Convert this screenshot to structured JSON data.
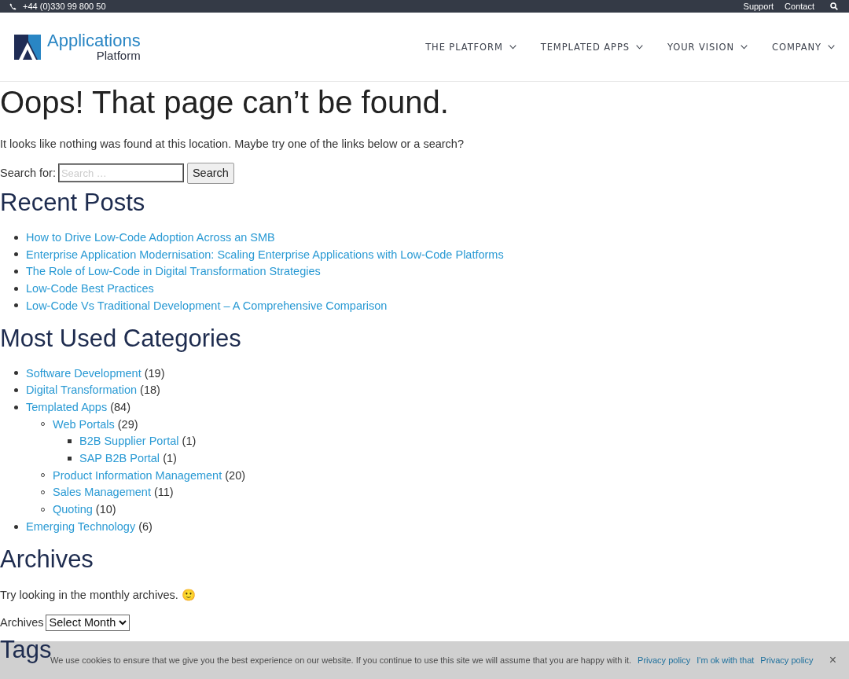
{
  "top_bar": {
    "phone": "+44 (0)330 99 800 50",
    "links": [
      "Support",
      "Contact"
    ]
  },
  "header": {
    "logo": {
      "line1": "Applications",
      "line2": "Platform"
    },
    "nav": [
      {
        "label": "THE PLATFORM"
      },
      {
        "label": "TEMPLATED APPS"
      },
      {
        "label": "YOUR VISION"
      },
      {
        "label": "COMPANY"
      }
    ]
  },
  "page": {
    "title": "Oops! That page can’t be found.",
    "message": "It looks like nothing was found at this location. Maybe try one of the links below or a search?",
    "search": {
      "label": "Search for:",
      "placeholder": "Search …",
      "button": "Search"
    },
    "recent_posts": {
      "heading": "Recent Posts",
      "items": [
        "How to Drive Low-Code Adoption Across an SMB",
        "Enterprise Application Modernisation: Scaling Enterprise Applications with Low-Code Platforms",
        "The Role of Low-Code in Digital Transformation Strategies",
        "Low-Code Best Practices",
        "Low-Code Vs Traditional Development – A Comprehensive Comparison"
      ]
    },
    "categories": {
      "heading": "Most Used Categories",
      "items": [
        {
          "name": "Software Development",
          "count": "(19)"
        },
        {
          "name": "Digital Transformation",
          "count": "(18)"
        },
        {
          "name": "Templated Apps",
          "count": "(84)",
          "children": [
            {
              "name": "Web Portals",
              "count": "(29)",
              "children": [
                {
                  "name": "B2B Supplier Portal",
                  "count": "(1)"
                },
                {
                  "name": "SAP B2B Portal",
                  "count": "(1)"
                }
              ]
            },
            {
              "name": "Product Information Management",
              "count": "(20)"
            },
            {
              "name": "Sales Management",
              "count": "(11)"
            },
            {
              "name": "Quoting",
              "count": "(10)"
            }
          ]
        },
        {
          "name": "Emerging Technology",
          "count": "(6)"
        }
      ]
    },
    "archives": {
      "heading": "Archives",
      "message": "Try looking in the monthly archives. 🙂",
      "label": "Archives",
      "select": "Select Month"
    },
    "tags": {
      "heading": "Tags"
    }
  },
  "cookie_notice": {
    "text": "We use cookies to ensure that we give you the best experience on our website. If you continue to use this site we will assume that you are happy with it.",
    "links": [
      "Privacy policy",
      "I'm ok with that",
      "Privacy policy"
    ],
    "close": "×"
  }
}
